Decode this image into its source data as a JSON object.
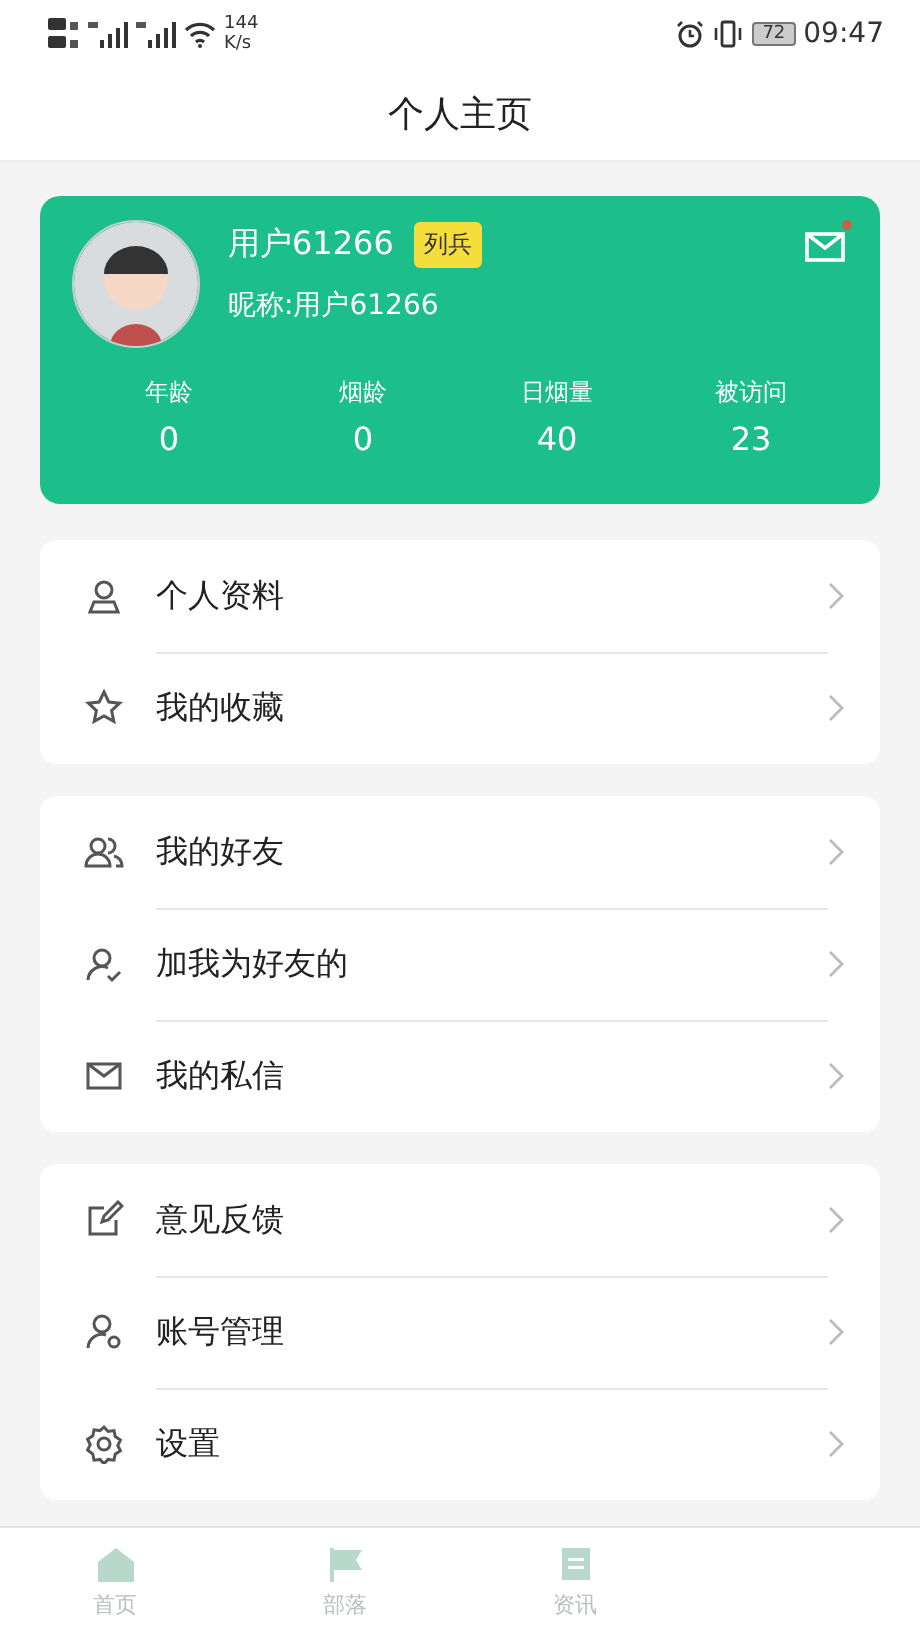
{
  "status_bar": {
    "speed": "144",
    "speed_unit": "K/s",
    "battery": "72",
    "time": "09:47"
  },
  "title": "个人主页",
  "profile": {
    "name": "用户61266",
    "rank": "列兵",
    "nickname": "昵称:用户61266",
    "unread": true,
    "stats": [
      {
        "label": "年龄",
        "value": "0"
      },
      {
        "label": "烟龄",
        "value": "0"
      },
      {
        "label": "日烟量",
        "value": "40"
      },
      {
        "label": "被访问",
        "value": "23"
      }
    ]
  },
  "groups": [
    [
      {
        "kind": "person",
        "label": "个人资料"
      },
      {
        "kind": "star",
        "label": "我的收藏"
      }
    ],
    [
      {
        "kind": "friends",
        "label": "我的好友"
      },
      {
        "kind": "person-check",
        "label": "加我为好友的"
      },
      {
        "kind": "mail",
        "label": "我的私信"
      }
    ],
    [
      {
        "kind": "edit",
        "label": "意见反馈"
      },
      {
        "kind": "account",
        "label": "账号管理"
      },
      {
        "kind": "gear",
        "label": "设置"
      }
    ]
  ],
  "tabs": [
    {
      "kind": "home",
      "label": "首页"
    },
    {
      "kind": "flag",
      "label": "部落"
    },
    {
      "kind": "news",
      "label": "资讯"
    }
  ]
}
